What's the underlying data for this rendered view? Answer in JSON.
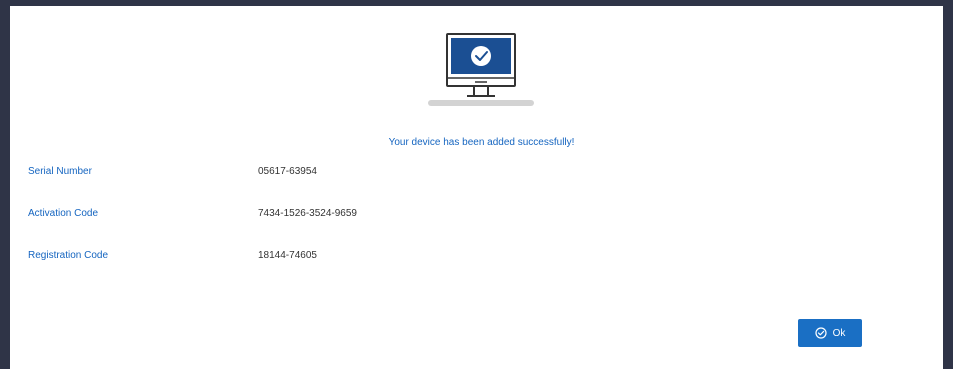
{
  "dialog": {
    "illustration_icon": "monitor-check-icon",
    "success_message": "Your device has been added successfully!",
    "fields": [
      {
        "label": "Serial Number",
        "value": "05617-63954"
      },
      {
        "label": "Activation Code",
        "value": "7434-1526-3524-9659"
      },
      {
        "label": "Registration Code",
        "value": "18144-74605"
      }
    ],
    "ok_button": {
      "label": "Ok",
      "icon": "check-circle-icon"
    }
  },
  "colors": {
    "accent": "#1565c0",
    "button": "#1a6fc4",
    "background": "#2f3447",
    "monitor_screen": "#1b4f93"
  }
}
